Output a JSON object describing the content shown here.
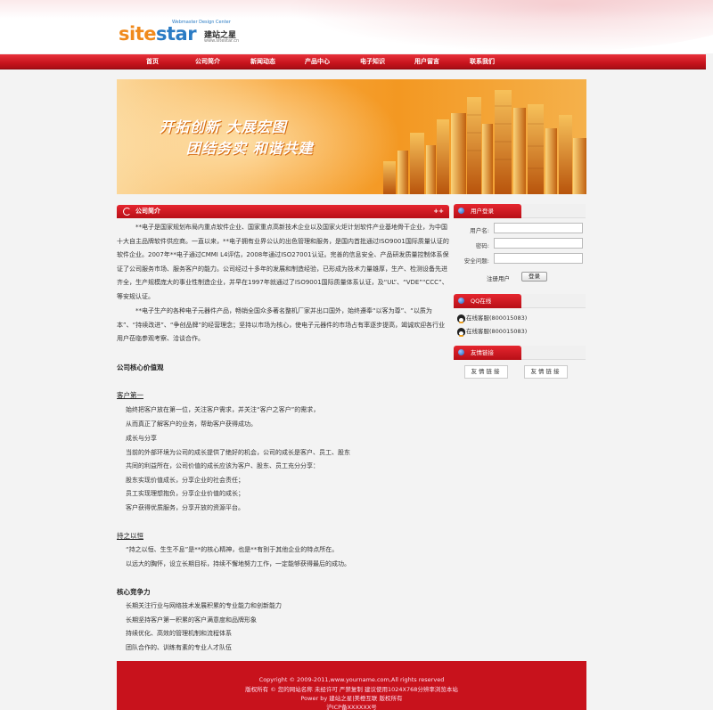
{
  "header": {
    "brand_a": "site",
    "brand_b": "star",
    "tagline": "Webmaster Design Center",
    "brand_cn": "建站之星",
    "brand_url": "www.sitestar.cn"
  },
  "nav": {
    "items": [
      "首页",
      "公司简介",
      "新闻动态",
      "产品中心",
      "电子知识",
      "用户留言",
      "联系我们"
    ]
  },
  "banner": {
    "slogan_1": "开拓创新 大展宏图",
    "slogan_2": "团结务实 和谐共建"
  },
  "main": {
    "title": "公司简介",
    "more": "++",
    "intro_1": "**电子是国家规划布局内重点软件企业、国家重点高新技术企业以及国家火炬计划软件产业基地骨干企业，为中国十大自主品牌软件供应商。一直以来，**电子拥有业界公认的出色管理和服务，是国内首批通过ISO9001国际质量认证的软件企业。2007年**电子通过CMMI L4评估，2008年通过ISO27001认证。完善的信息安全、产品研发质量控制体系保证了公司服务市场、服务客户的能力。公司经过十多年的发展和制造经验，已形成为技术力量雄厚，生产、检测设备先进齐全，生产规模庞大的事业性制造企业，并早在1997年就通过了ISO9001国际质量体系认证，及“UL”、“VDE”“CCC”、等安规认证。",
    "intro_2": "**电子生产的各种电子元器件产品，畅销全国众多著名整机厂家并出口国外，始终遵奉“以客为尊”、“以质为本”、“持续改进”、“争创品牌”的经营理念；坚持以市场为核心，使电子元器件的市场占有率逐步提高，竭诚欢迎各行业用户莅临参观考察、洽谈合作。",
    "values_title": "公司核心价值观",
    "customer_title": "客户第一",
    "customer_lines": [
      "始终把客户放在第一位，关注客户需求，并关注“客户之客户”的需求，",
      "从而真正了解客户的业务，帮助客户获得成功。",
      "成长与分享",
      "当前的外部环境为公司的成长提供了绝好的机会，公司的成长是客户、员工、股东",
      "共同的利益所在，公司价值的成长应该为客户、股东、员工充分分享：",
      "股东实现价值成长，分享企业的社会责任；",
      "员工实现理想抱负，分享企业价值的成长；",
      "客户获得优质服务，分享开放的资源平台。"
    ],
    "persist_title": "持之以恒",
    "persist_lines": [
      "“持之以恒、生生不息”是**的核心精神，也是**有别于其他企业的特点所在。",
      "以远大的胸怀，设立长期目标，持续不懈地努力工作，一定能够获得最后的成功。"
    ],
    "core_title": "核心竞争力",
    "core_lines": [
      "长期关注行业与网络技术发展积累的专业能力和创新能力",
      "长期坚持客户第一积累的客户满意度和品牌形象",
      "持续优化、高效的管理机制和流程体系",
      "团队合作的、训练有素的专业人才队伍"
    ]
  },
  "sidebar": {
    "login": {
      "title": "用户登录",
      "username_label": "用户名:",
      "password_label": "密码:",
      "question_label": "安全问题:",
      "register": "注册用户",
      "login_button": "登录"
    },
    "qq": {
      "title": "QQ在线",
      "items": [
        "在线客服(800015083)",
        "在线客服(800015083)"
      ]
    },
    "links": {
      "title": "友情链接",
      "items": [
        "友情链接",
        "友情链接"
      ]
    }
  },
  "footer": {
    "line1": "Copyright © 2009-2011,www.yourname.com,All rights reserved",
    "line2": "版权所有 © 您的网站名称  未经许可  严禁复制  建议使用1024X768分辨率浏览本站",
    "line3": "Power by 建站之星|美橙互联 版权所有",
    "line4": "沪ICP备XXXXXX号"
  },
  "colors": {
    "primary_red": "#c8121c",
    "banner_orange": "#f39822",
    "logo_orange": "#f08a1c",
    "logo_blue": "#2a7bc4"
  }
}
